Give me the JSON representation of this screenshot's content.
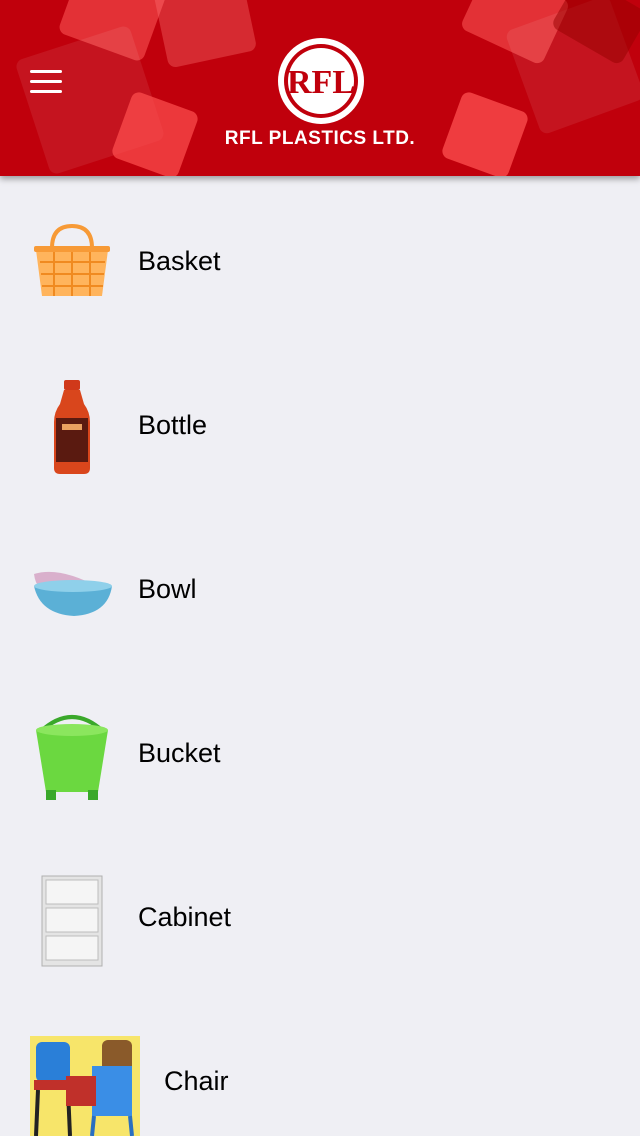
{
  "header": {
    "brand_emblem": "RFL",
    "brand_name": "RFL PLASTICS LTD.",
    "menu_icon": "hamburger-menu-icon",
    "background_color": "#c0000c"
  },
  "categories": [
    {
      "label": "Basket",
      "icon": "basket-image"
    },
    {
      "label": "Bottle",
      "icon": "bottle-image"
    },
    {
      "label": "Bowl",
      "icon": "bowl-image"
    },
    {
      "label": "Bucket",
      "icon": "bucket-image"
    },
    {
      "label": "Cabinet",
      "icon": "cabinet-image"
    },
    {
      "label": "Chair",
      "icon": "chair-image"
    }
  ]
}
